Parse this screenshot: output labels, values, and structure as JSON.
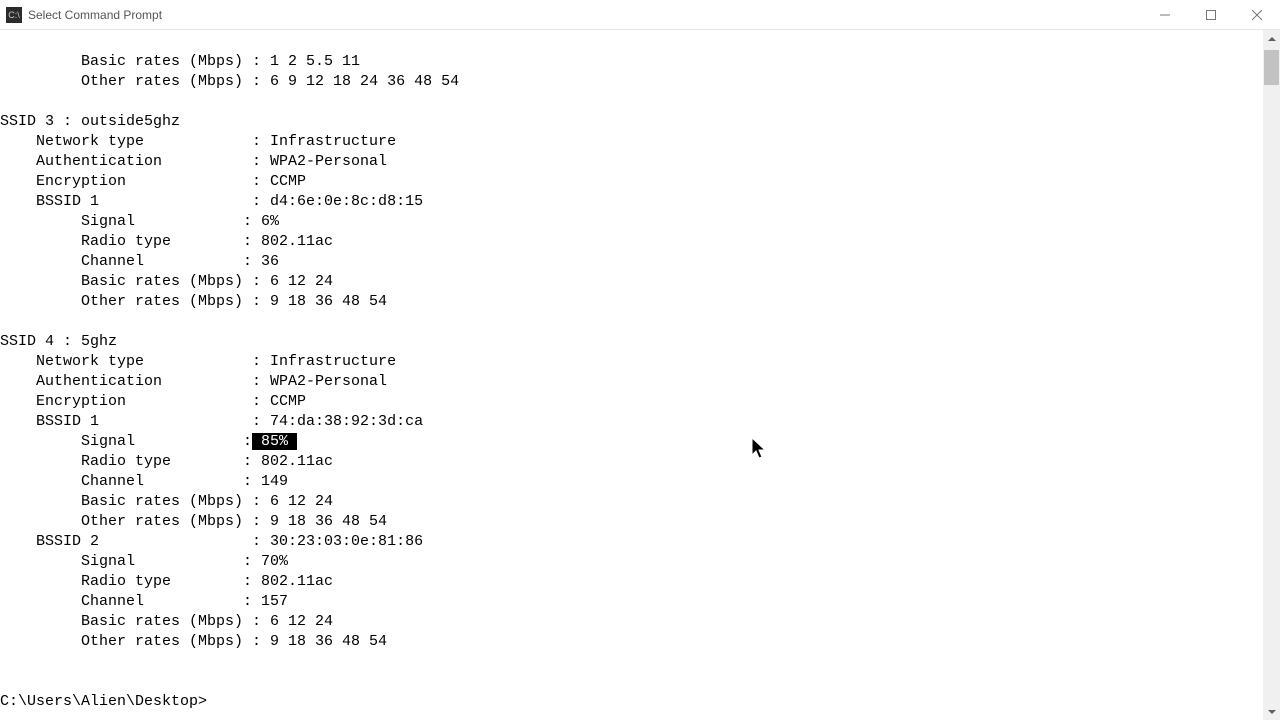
{
  "window": {
    "title": "Select Command Prompt",
    "icon_label": "C:\\"
  },
  "top_fragment": {
    "basic_rates": "Basic rates (Mbps) : 1 2 5.5 11",
    "other_rates": "Other rates (Mbps) : 6 9 12 18 24 36 48 54"
  },
  "ssid3": {
    "header": "SSID 3 : outside5ghz",
    "network_type": "    Network type            : Infrastructure",
    "authentication": "    Authentication          : WPA2-Personal",
    "encryption": "    Encryption              : CCMP",
    "bssid1": "    BSSID 1                 : d4:6e:0e:8c:d8:15",
    "signal": "         Signal            : 6%",
    "radio": "         Radio type        : 802.11ac",
    "channel": "         Channel           : 36",
    "basic_rates": "         Basic rates (Mbps) : 6 12 24",
    "other_rates": "         Other rates (Mbps) : 9 18 36 48 54"
  },
  "ssid4": {
    "header": "SSID 4 : 5ghz",
    "network_type": "    Network type            : Infrastructure",
    "authentication": "    Authentication          : WPA2-Personal",
    "encryption": "    Encryption              : CCMP",
    "bssid1": "    BSSID 1                 : 74:da:38:92:3d:ca",
    "signal_prefix": "         Signal            :",
    "signal_selected": " 85% ",
    "radio1": "         Radio type        : 802.11ac",
    "channel1": "         Channel           : 149",
    "basic_rates1": "         Basic rates (Mbps) : 6 12 24",
    "other_rates1": "         Other rates (Mbps) : 9 18 36 48 54",
    "bssid2": "    BSSID 2                 : 30:23:03:0e:81:86",
    "signal2": "         Signal            : 70%",
    "radio2": "         Radio type        : 802.11ac",
    "channel2": "         Channel           : 157",
    "basic_rates2": "         Basic rates (Mbps) : 6 12 24",
    "other_rates2": "         Other rates (Mbps) : 9 18 36 48 54"
  },
  "prompt": "C:\\Users\\Alien\\Desktop>"
}
